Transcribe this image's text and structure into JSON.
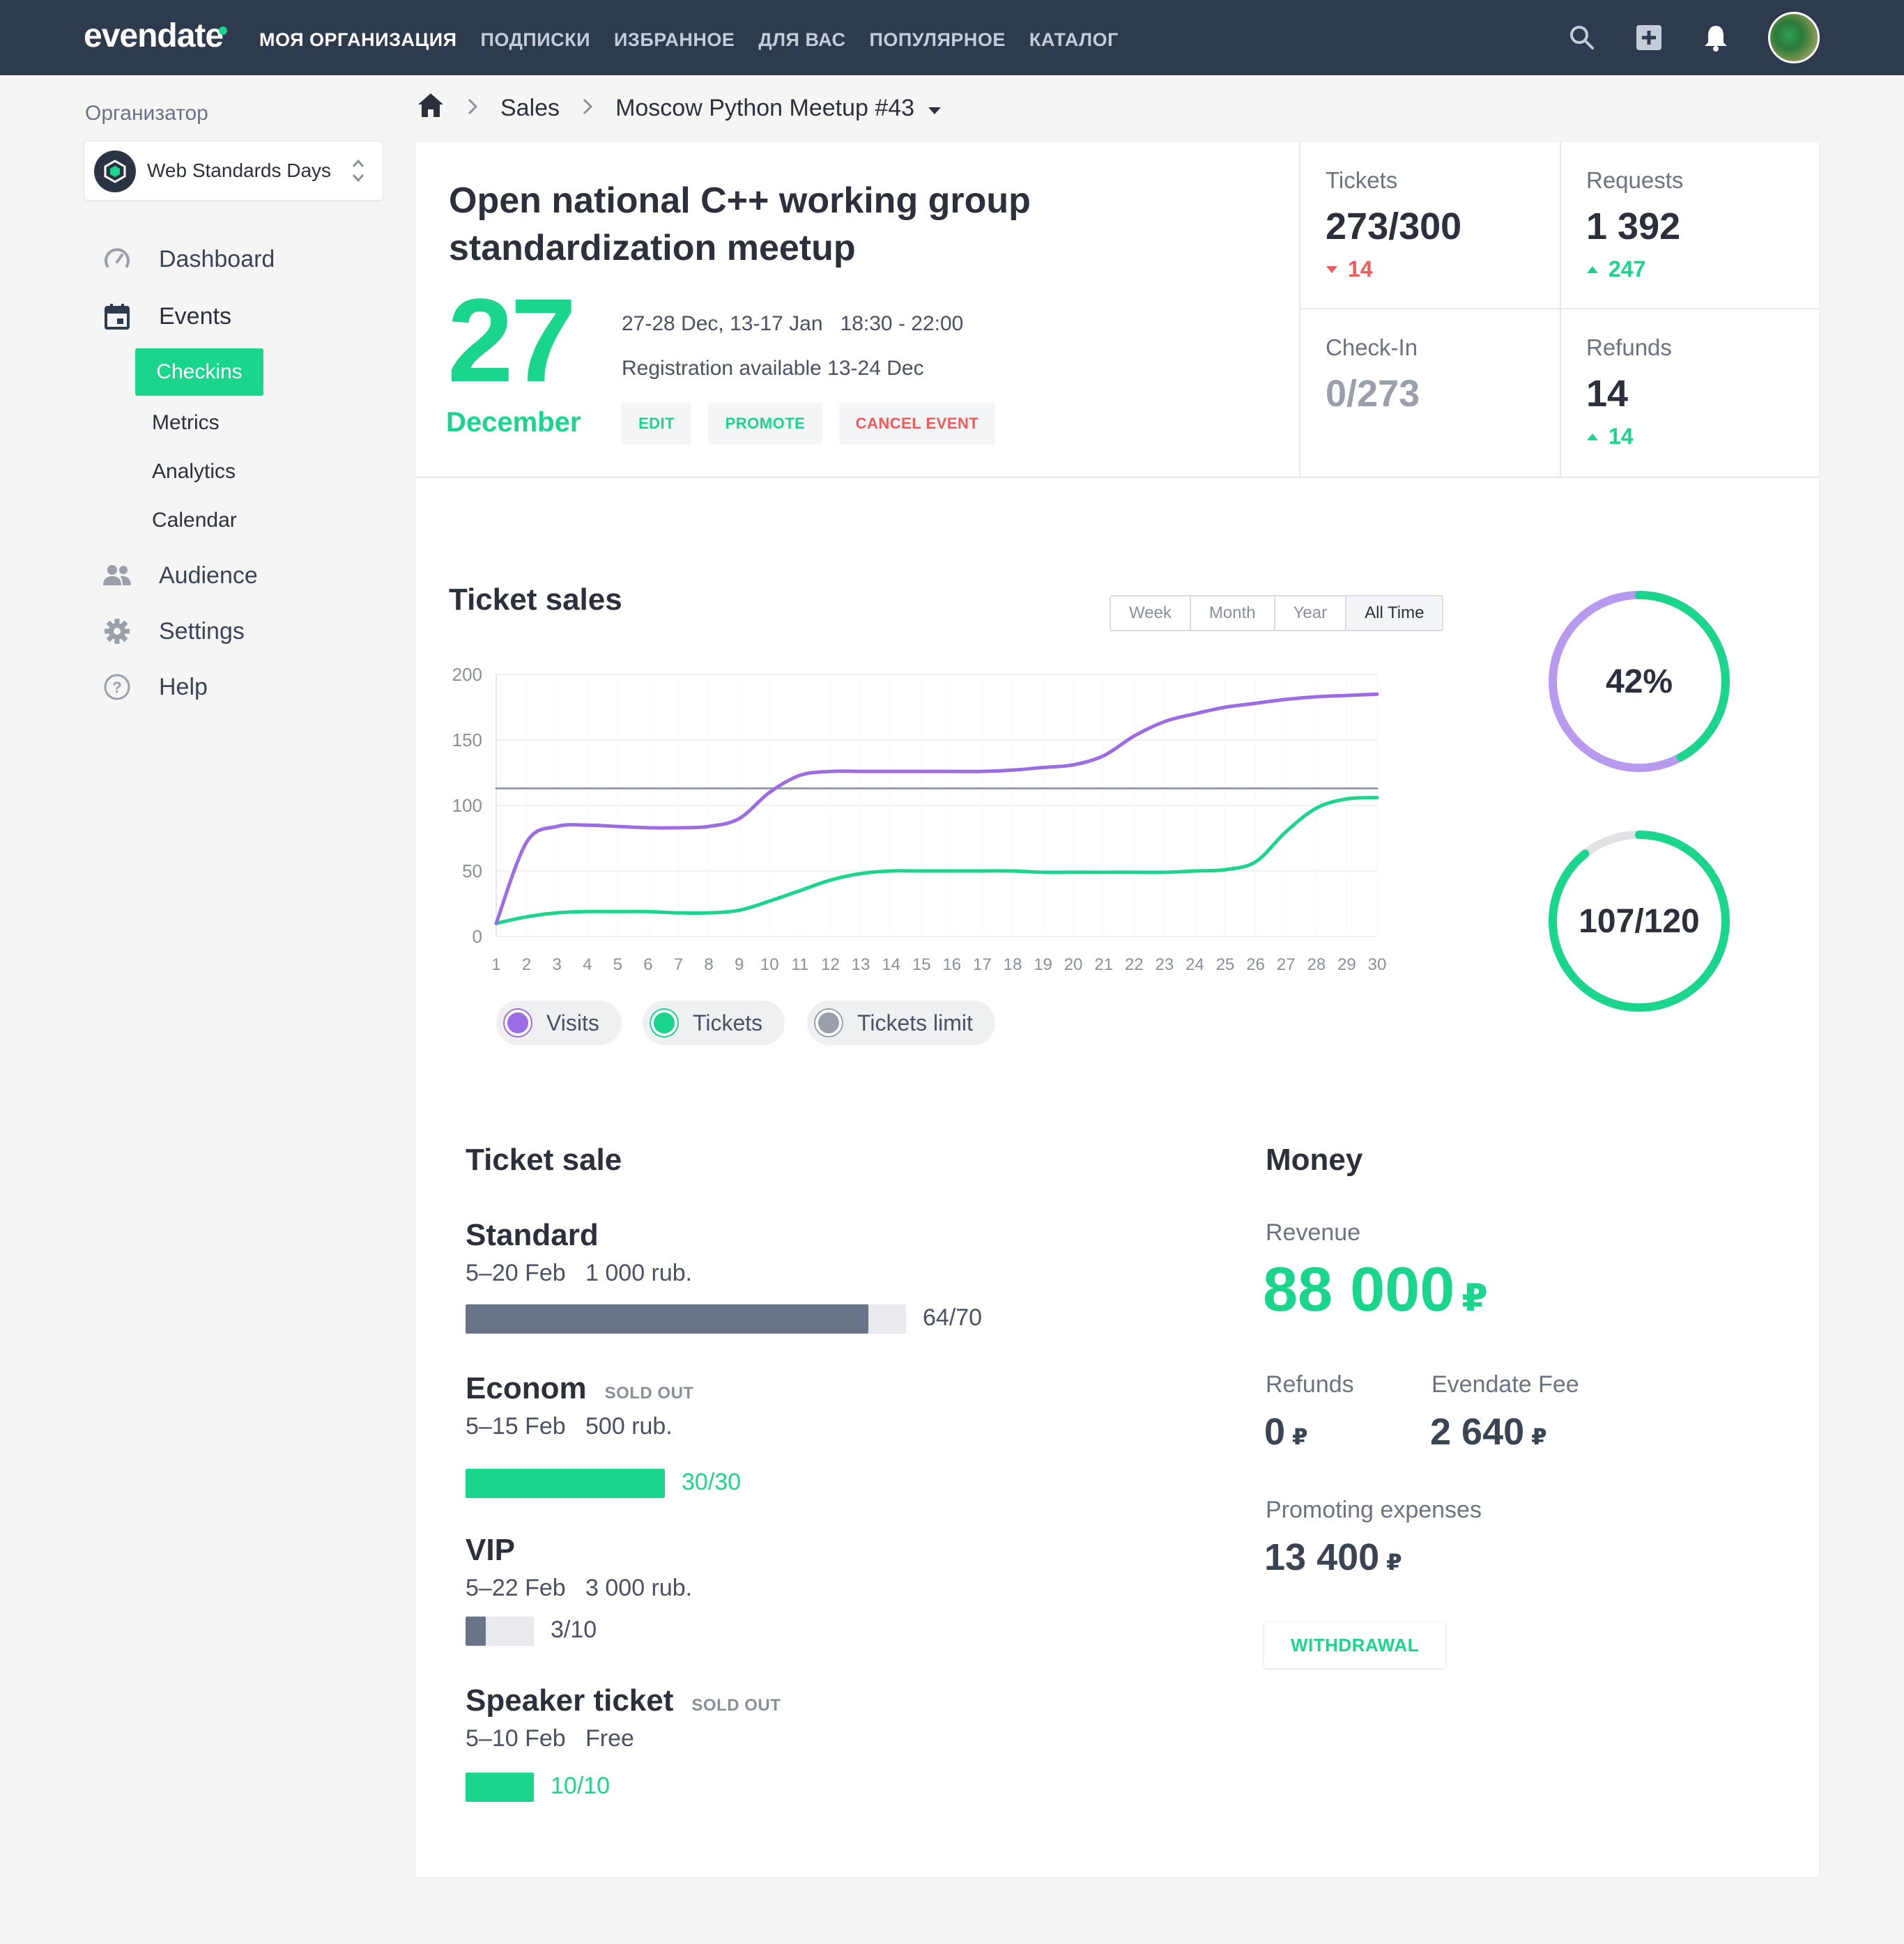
{
  "topbar": {
    "logo": "evendate",
    "nav": [
      "МОЯ ОРГАНИЗАЦИЯ",
      "ПОДПИСКИ",
      "ИЗБРАННОЕ",
      "ДЛЯ ВАС",
      "ПОПУЛЯРНОЕ",
      "КАТАЛОГ"
    ],
    "icons": [
      "search-icon",
      "add-icon",
      "bell-icon"
    ]
  },
  "sidebar": {
    "organizer_label": "Организатор",
    "org_name": "Web Standards Days",
    "items": [
      {
        "label": "Dashboard",
        "icon": "dashboard-icon"
      },
      {
        "label": "Events",
        "icon": "calendar-icon"
      },
      {
        "label": "Audience",
        "icon": "people-icon"
      },
      {
        "label": "Settings",
        "icon": "gear-icon"
      },
      {
        "label": "Help",
        "icon": "help-icon"
      }
    ],
    "sub_items": [
      "Checkins",
      "Metrics",
      "Analytics",
      "Calendar"
    ]
  },
  "breadcrumb": {
    "section": "Sales",
    "event": "Moscow Python Meetup #43"
  },
  "event": {
    "title": "Open national C++ working group standardization meetup",
    "day": "27",
    "month": "December",
    "dates": "27-28 Dec, 13-17 Jan",
    "time": "18:30 - 22:00",
    "registration": "Registration available 13-24 Dec",
    "edit_label": "EDIT",
    "promote_label": "PROMOTE",
    "cancel_label": "CANCEL EVENT"
  },
  "stats": {
    "tickets": {
      "label": "Tickets",
      "value": "273/300",
      "delta": "14",
      "delta_dir": "down"
    },
    "requests": {
      "label": "Requests",
      "value": "1 392",
      "delta": "247",
      "delta_dir": "up"
    },
    "checkin": {
      "label": "Check-In",
      "value": "0/273"
    },
    "refunds": {
      "label": "Refunds",
      "value": "14",
      "delta": "14",
      "delta_dir": "up"
    }
  },
  "colors": {
    "accent": "#1ad68d",
    "visits": "#9b6ce4",
    "limit": "#9aa0a9",
    "danger": "#f05a5a",
    "topbar": "#2e3b4e"
  },
  "ticket_sales": {
    "title": "Ticket sales",
    "ranges": [
      "Week",
      "Month",
      "Year",
      "All Time"
    ],
    "selected_range": "All Time",
    "legend": [
      "Visits",
      "Tickets",
      "Tickets limit"
    ]
  },
  "chart_data": {
    "type": "line",
    "x": [
      1,
      2,
      3,
      4,
      5,
      6,
      7,
      8,
      9,
      10,
      11,
      12,
      13,
      14,
      15,
      16,
      17,
      18,
      19,
      20,
      21,
      22,
      23,
      24,
      25,
      26,
      27,
      28,
      29,
      30
    ],
    "ylim": [
      0,
      200
    ],
    "yticks": [
      0,
      50,
      100,
      150,
      200
    ],
    "grid": true,
    "series": [
      {
        "name": "Visits",
        "values": [
          10,
          72,
          84,
          85,
          84,
          83,
          83,
          84,
          90,
          110,
          123,
          126,
          126,
          126,
          126,
          126,
          126,
          127,
          129,
          131,
          138,
          153,
          164,
          170,
          175,
          178,
          181,
          183,
          184,
          185
        ]
      },
      {
        "name": "Tickets",
        "values": [
          10,
          15,
          18,
          19,
          19,
          19,
          18,
          18,
          20,
          27,
          35,
          43,
          48,
          50,
          50,
          50,
          50,
          50,
          49,
          49,
          49,
          49,
          49,
          50,
          51,
          57,
          80,
          98,
          105,
          106
        ]
      },
      {
        "name": "Tickets limit",
        "values": [
          113,
          113,
          113,
          113,
          113,
          113,
          113,
          113,
          113,
          113,
          113,
          113,
          113,
          113,
          113,
          113,
          113,
          113,
          113,
          113,
          113,
          113,
          113,
          113,
          113,
          113,
          113,
          113,
          113,
          113
        ]
      }
    ]
  },
  "rings": [
    {
      "label": "42%",
      "fraction": 0.42
    },
    {
      "label": "107/120",
      "fraction": 0.892
    }
  ],
  "ticket_sale": {
    "title": "Ticket sale",
    "sold_out_label": "SOLD OUT",
    "types": [
      {
        "name": "Standard",
        "dates": "5–20 Feb",
        "price": "1 000 rub.",
        "count": "64/70",
        "sold": 64,
        "total": 70,
        "sold_out": false
      },
      {
        "name": "Econom",
        "dates": "5–15 Feb",
        "price": "500 rub.",
        "count": "30/30",
        "sold": 30,
        "total": 30,
        "sold_out": true
      },
      {
        "name": "VIP",
        "dates": "5–22 Feb",
        "price": "3 000 rub.",
        "count": "3/10",
        "sold": 3,
        "total": 10,
        "sold_out": false
      },
      {
        "name": "Speaker ticket",
        "dates": "5–10 Feb",
        "price": "Free",
        "count": "10/10",
        "sold": 10,
        "total": 10,
        "sold_out": true
      }
    ]
  },
  "money": {
    "title": "Money",
    "revenue_label": "Revenue",
    "revenue": "88 000",
    "currency": "₽",
    "refunds_label": "Refunds",
    "refunds": "0",
    "fee_label": "Evendate Fee",
    "fee": "2 640",
    "promo_label": "Promoting expenses",
    "promo": "13 400",
    "withdraw_label": "WITHDRAWAL"
  }
}
